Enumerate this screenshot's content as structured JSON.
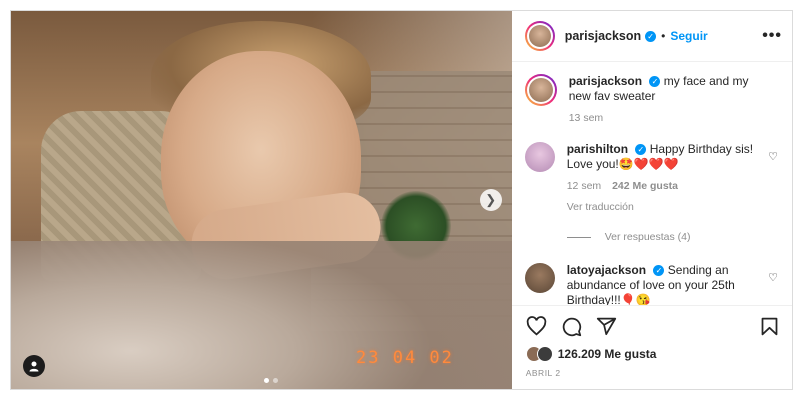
{
  "post": {
    "photo_stamp": "23 04 02",
    "carousel": {
      "dots": 2,
      "active": 0
    },
    "icons": {
      "next": "chevron-right-icon",
      "tag": "user-tag-icon"
    }
  },
  "header": {
    "username": "parisjackson",
    "separator": "•",
    "follow_label": "Seguir",
    "more_label": "•••",
    "verified_icon": "verified-badge-icon"
  },
  "caption": {
    "username": "parisjackson",
    "text": "my face and my new fav sweater",
    "time": "13 sem"
  },
  "comments": [
    {
      "username": "parishilton",
      "text": "Happy Birthday sis! Love you!🤩❤️❤️❤️",
      "time": "12 sem",
      "likes": "242 Me gusta",
      "translate": "Ver traducción",
      "replies": "Ver respuestas (4)",
      "avatar_color": "#b48bb4"
    },
    {
      "username": "latoyajackson",
      "text": "Sending an abundance of love on your 25th Birthday!!!🎈😘",
      "avatar_color": "#5a4636"
    }
  ],
  "footer": {
    "likes_text": "126.209 Me gusta",
    "date": "ABRIL 2",
    "icons": [
      "heart-icon",
      "comment-icon",
      "share-icon",
      "bookmark-icon"
    ]
  },
  "colors": {
    "accent": "#0095f6",
    "stamp": "#ff8a3d"
  }
}
